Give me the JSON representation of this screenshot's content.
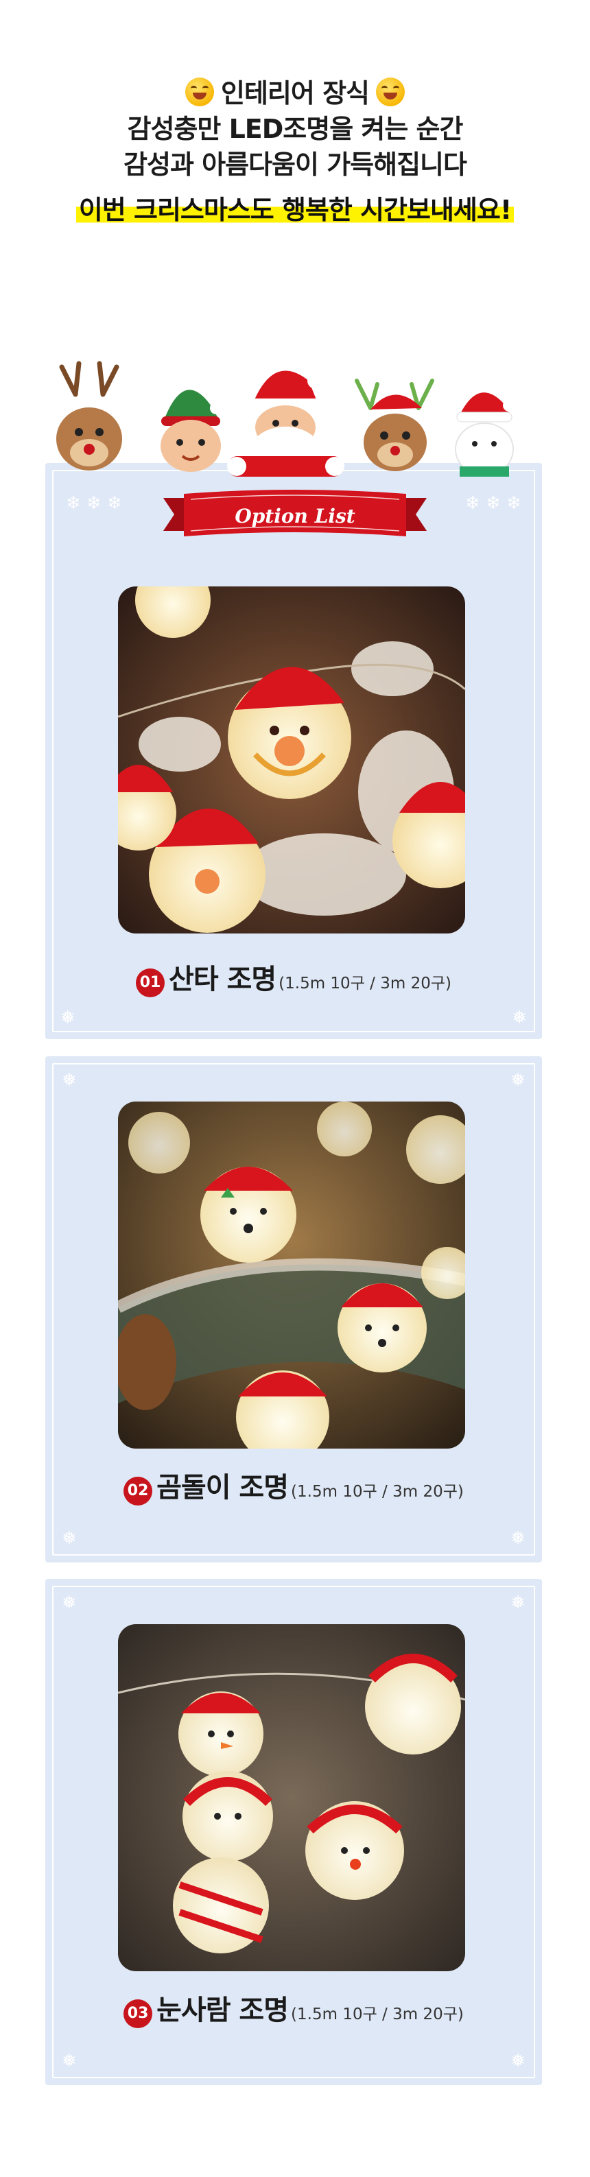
{
  "intro": {
    "line1": "인테리어 장식",
    "line2": "감성충만 LED조명을 켜는 순간",
    "line3": "감성과 아름다움이 가득해집니다",
    "highlight": "이번 크리스마스도 행복한 시간보내세요!"
  },
  "banner": {
    "label": "Option List"
  },
  "options": [
    {
      "number": "01",
      "title": "산타 조명",
      "detail": "(1.5m  10구 / 3m  20구)"
    },
    {
      "number": "02",
      "title": "곰돌이 조명",
      "detail": "(1.5m  10구 / 3m  20구)"
    },
    {
      "number": "03",
      "title": "눈사람 조명",
      "detail": "(1.5m  10구 / 3m  20구)"
    }
  ],
  "colors": {
    "accent_red": "#c8141c",
    "panel_blue": "#dfe8f6",
    "highlight_yellow": "#fff200"
  },
  "icons": [
    "grinning-emoji-icon",
    "heart-eyes-emoji-icon",
    "snowflake-icon"
  ]
}
